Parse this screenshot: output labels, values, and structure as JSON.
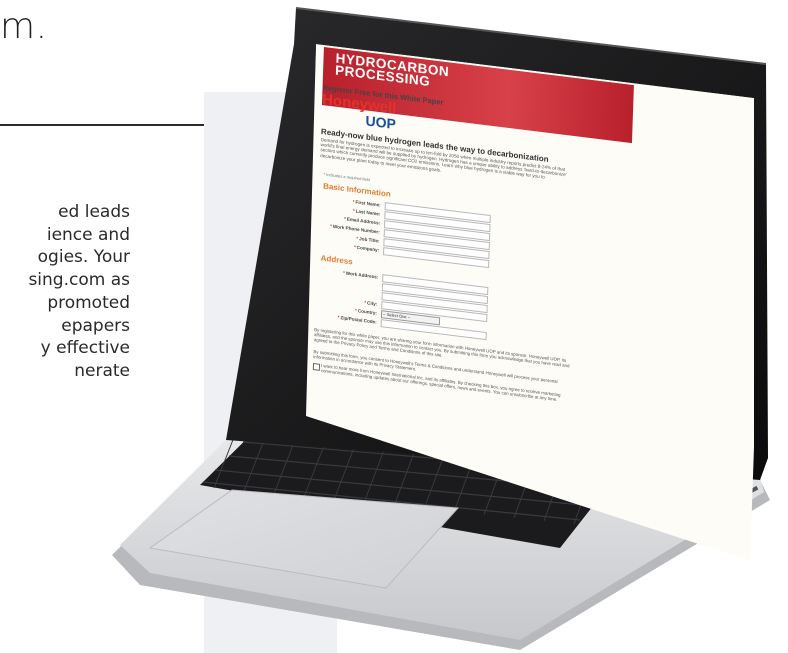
{
  "page": {
    "title_fragment": "m.",
    "body_lines": [
      "ed leads",
      "ience and",
      "ogies. Your",
      "sing.com as",
      "promoted",
      "epapers",
      "y effective",
      "nerate"
    ]
  },
  "screen": {
    "banner_title": "HYDROCARBON\nPROCESSING",
    "register_label": "Register Free for this White Paper",
    "logo_honeywell": "Honeywell",
    "logo_uop": "UOP",
    "headline": "Ready-now blue hydrogen leads the way to decarbonization",
    "intro_paragraph": "Demand for hydrogen is expected to increase up to ten-fold by 2050 when multiple industry reports predict 8-24% of that world's final energy demand will be supplied by hydrogen. Hydrogen has a unique ability to address 'hard-to-decarbonize' sectors which currently produce significant CO2 emissions. Learn why blue hydrogen is a viable way for you to decarbonize your plant today to meet your emissions goals.",
    "required_note": "* Indicates a required field",
    "basic_info_heading": "Basic Information",
    "basic_fields": [
      "First Name:",
      "Last Name:",
      "Email Address:",
      "Work Phone Number:",
      "Job Title:",
      "Company:"
    ],
    "address_heading": "Address",
    "work_address_label": "Work Address:",
    "city_label": "City:",
    "country_label": "Country:",
    "country_select": "-- Select One --",
    "zip_label": "Zip/Postal Code:",
    "legal_1": "By registering for this white paper, you are sharing your form information with Honeywell UOP and its sponsor. Honeywell UOP, its affiliates, and the sponsor may use this information to contact you. By submitting this form you acknowledge that you have read and agreed to the Privacy Policy and Terms and Conditions of this site.",
    "legal_2": "By submitting this form, you consent to Honeywell's Terms & Conditions and understand Honeywell will process your personal information in accordance with its Privacy Statement.",
    "checkbox_text": "I want to hear more from Honeywell International Inc. and its affiliates. By checking this box, you agree to receive marketing communications, including updates about our offerings, special offers, news and events. You can unsubscribe at any time."
  },
  "colors": {
    "banner_red": "#c62a34",
    "honeywell_red": "#e4322b",
    "uop_blue": "#1c4d9c",
    "section_orange": "#e17d33",
    "laptop_silver": "#d9dbde",
    "bezel_black": "#111111"
  }
}
